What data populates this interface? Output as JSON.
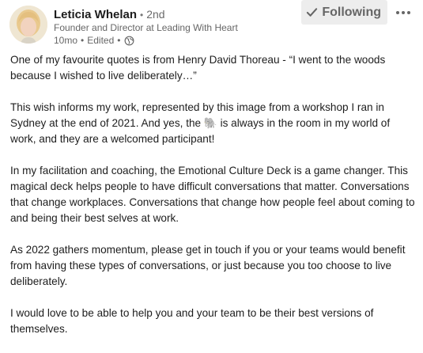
{
  "author": {
    "name": "Leticia Whelan",
    "separator": "•",
    "degree": "2nd",
    "headline": "Founder and Director at Leading With Heart",
    "time": "10mo",
    "edited": "Edited",
    "visibility_icon": "globe-icon"
  },
  "actions": {
    "follow_label": "Following",
    "follow_icon": "check-icon",
    "more_icon": "more-horizontal-icon"
  },
  "post": {
    "p1": "One of my favourite quotes is from Henry David Thoreau - “I went to the woods because I wished to live deliberately…”",
    "p2_before": "This wish informs my work, represented by this image from a workshop I ran in Sydney at the end of 2021. And yes, the ",
    "p2_emoji": "🐘",
    "p2_after": " is always in the room in my world of work, and they are a welcomed participant!",
    "p3": "In my facilitation and coaching, the Emotional Culture Deck is a game changer. This magical deck helps people to have difficult conversations that matter. Conversations that change workplaces. Conversations that change how people feel about coming to and being their best selves at work.",
    "p4": "As 2022 gathers momentum, please get in touch if you or your teams would benefit from having these types of conversations, or just because you too choose to live deliberately.",
    "p5": "I would love to be able to help you and your team to be their best versions of themselves."
  },
  "colors": {
    "follow_bg": "#ededed",
    "secondary_text": "#666666",
    "primary_text": "#1d1d1d"
  }
}
